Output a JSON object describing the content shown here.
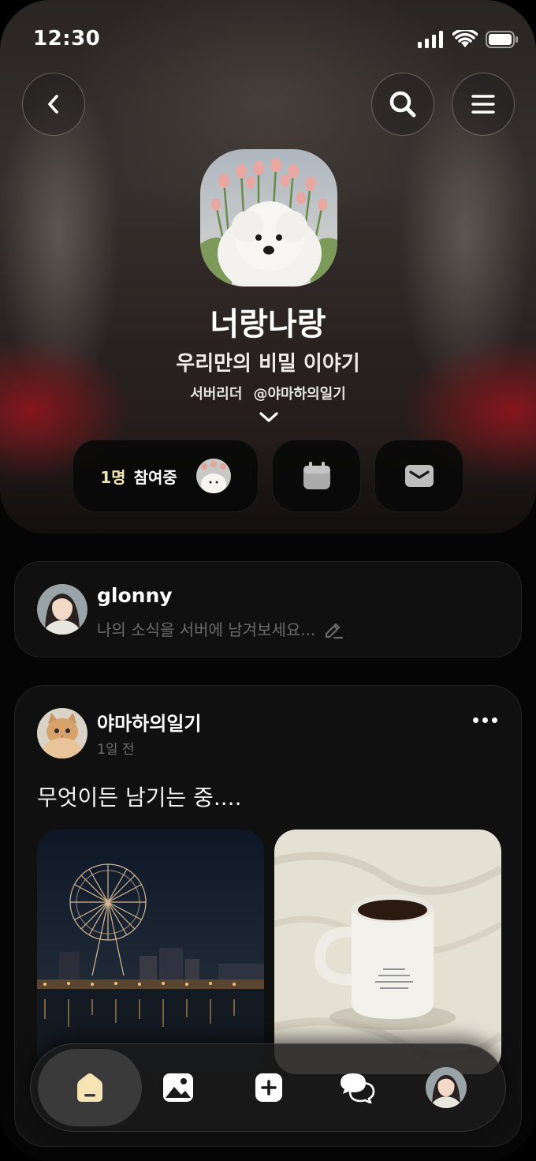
{
  "status_bar": {
    "time": "12:30"
  },
  "header": {
    "back_icon": "chevron-left-icon",
    "search_icon": "search-icon",
    "menu_icon": "hamburger-menu-icon"
  },
  "server": {
    "name": "너랑나랑",
    "description": "우리만의 비밀 이야기",
    "leader_label": "서버리더",
    "leader_handle": "@야마하의일기",
    "participants_count": "1명",
    "participants_label": "참여중"
  },
  "actions": {
    "calendar_icon": "calendar-icon",
    "mail_icon": "mail-icon"
  },
  "composer": {
    "username": "glonny",
    "placeholder": "나의 소식을 서버에 남겨보세요..."
  },
  "post": {
    "author": "야마하의일기",
    "time": "1일 전",
    "text": "무엇이든 남기는 중...."
  },
  "tabbar": {
    "items": [
      "home-icon",
      "gallery-icon",
      "add-icon",
      "chat-icon",
      "profile-avatar"
    ],
    "active": "home-icon"
  },
  "colors": {
    "background": "#000000",
    "card": "#101010",
    "accent_cream": "#f4e6b3",
    "muted_text": "#6b6b6b"
  }
}
